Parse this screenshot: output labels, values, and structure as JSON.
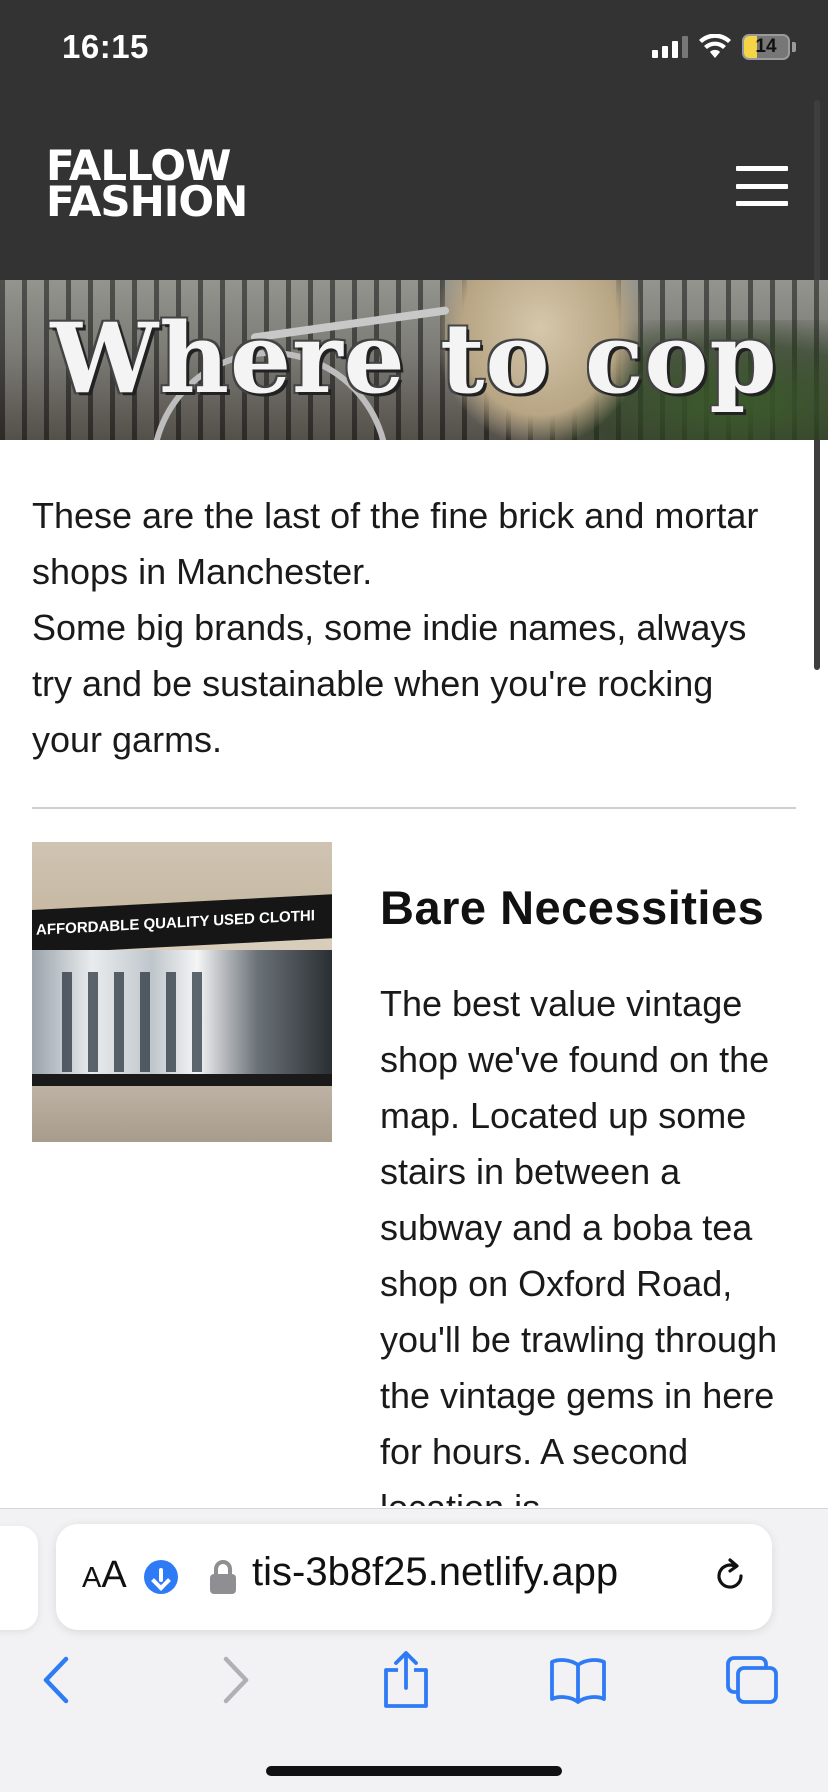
{
  "status_bar": {
    "time": "16:15",
    "battery_level": "14",
    "icons": [
      "signal-icon",
      "wifi-icon",
      "battery-icon"
    ]
  },
  "site": {
    "logo_line1": "FALLOW",
    "logo_line2": "FASHION",
    "menu_icon": "hamburger-menu-icon"
  },
  "hero": {
    "title": "Where to cop"
  },
  "intro": {
    "line1": "These are the last of the fine brick and mortar shops in Manchester.",
    "line2": "Some big brands, some indie names, always try and be sustainable when you're rocking your garms."
  },
  "shop": {
    "name": "Bare Necessities",
    "image_sign_text": "AFFORDABLE  QUALITY  USED  CLOTHI",
    "description": "The best value vintage shop we've found on the map. Located up some stairs in between a subway and a boba tea shop on Oxford Road, you'll be trawling through the vintage gems in here for hours. A second location is"
  },
  "browser": {
    "aa_label_small": "A",
    "aa_label_large": "A",
    "url": "tis-3b8f25.netlify.app",
    "icons": [
      "download-icon",
      "lock-icon",
      "reload-icon",
      "back-icon",
      "forward-icon",
      "share-icon",
      "bookmarks-icon",
      "tabs-icon"
    ],
    "accent_color": "#2f7bf5",
    "disabled_color": "#b0b0b5"
  },
  "colors": {
    "header_bg": "#333333",
    "page_bg": "#ffffff",
    "text": "#1a1a1a"
  }
}
